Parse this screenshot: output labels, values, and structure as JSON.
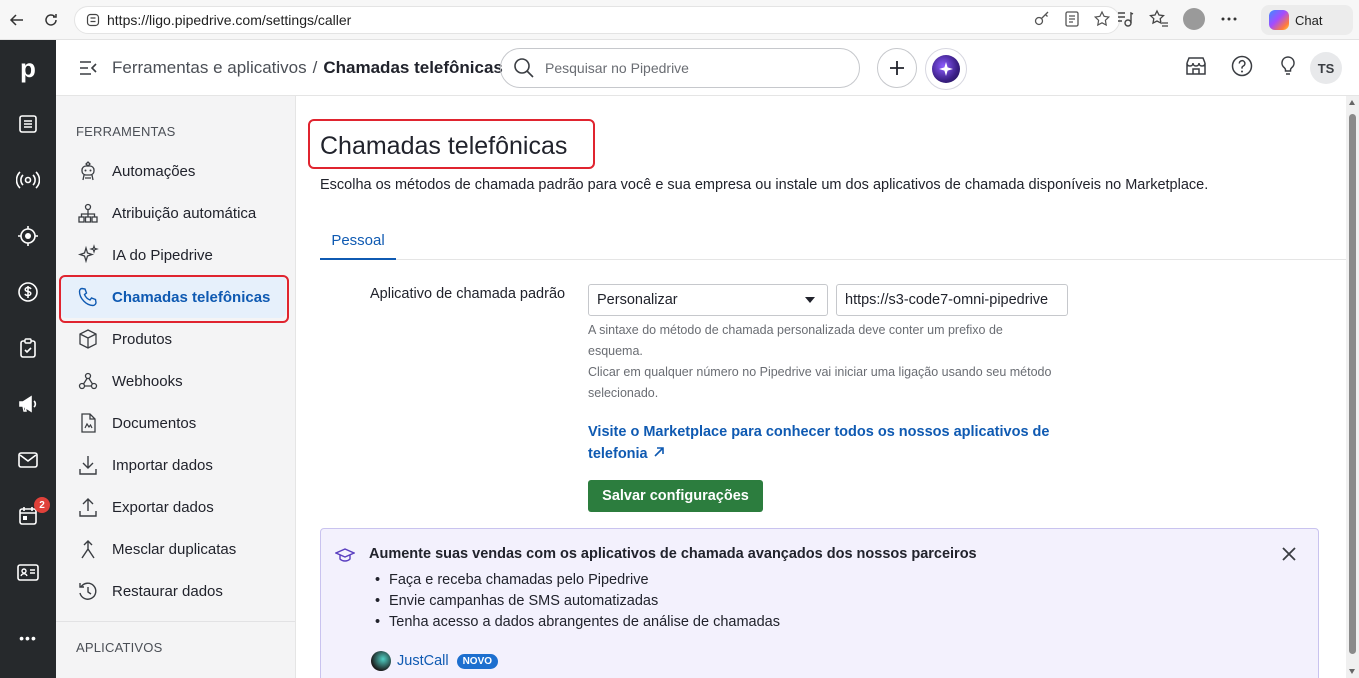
{
  "browser": {
    "url": "https://ligo.pipedrive.com/settings/caller",
    "chat_label": "Chat"
  },
  "rail": {
    "logo": "p",
    "badge_count": "2",
    "more": "•••"
  },
  "header": {
    "breadcrumb_parent": "Ferramentas e aplicativos",
    "breadcrumb_sep": "/",
    "breadcrumb_current": "Chamadas telefônicas",
    "search_placeholder": "Pesquisar no Pipedrive",
    "avatar_initials": "TS"
  },
  "sidebar": {
    "section_tools": "FERRAMENTAS",
    "section_apps": "APLICATIVOS",
    "items": [
      {
        "label": "Automações",
        "icon": "robot-icon"
      },
      {
        "label": "Atribuição automática",
        "icon": "assignment-icon"
      },
      {
        "label": "IA do Pipedrive",
        "icon": "sparkle-icon"
      },
      {
        "label": "Chamadas telefônicas",
        "icon": "phone-icon"
      },
      {
        "label": "Produtos",
        "icon": "box-icon"
      },
      {
        "label": "Webhooks",
        "icon": "webhook-icon"
      },
      {
        "label": "Documentos",
        "icon": "document-icon"
      },
      {
        "label": "Importar dados",
        "icon": "import-icon"
      },
      {
        "label": "Exportar dados",
        "icon": "export-icon"
      },
      {
        "label": "Mesclar duplicatas",
        "icon": "merge-icon"
      },
      {
        "label": "Restaurar dados",
        "icon": "restore-icon"
      }
    ]
  },
  "main": {
    "title": "Chamadas telefônicas",
    "description": "Escolha os métodos de chamada padrão para você e sua empresa ou instale um dos aplicativos de chamada disponíveis no Marketplace.",
    "tab_personal": "Pessoal",
    "field_label": "Aplicativo de chamada padrão",
    "select_value": "Personalizar",
    "url_value": "https://s3-code7-omni-pipedrive",
    "hint_line1": "A sintaxe do método de chamada personalizada deve conter um prefixo de",
    "hint_line2": "esquema.",
    "hint_line3": "Clicar em qualquer número no Pipedrive vai iniciar uma ligação usando seu método",
    "hint_line4": "selecionado.",
    "marketplace_link": "Visite o Marketplace para conhecer todos os nossos aplicativos de telefonia",
    "save_button": "Salvar configurações"
  },
  "promo": {
    "title": "Aumente suas vendas com os aplicativos de chamada avançados dos nossos parceiros",
    "bullets": [
      "Faça e receba chamadas pelo Pipedrive",
      "Envie campanhas de SMS automatizadas",
      "Tenha acesso a dados abrangentes de análise de chamadas"
    ],
    "partner_name": "JustCall",
    "partner_badge": "NOVO"
  },
  "colors": {
    "accent_blue": "#0f5ab2",
    "save_green": "#2c7d3e",
    "rail_bg": "#26292c",
    "highlight_red": "#e0242f"
  }
}
